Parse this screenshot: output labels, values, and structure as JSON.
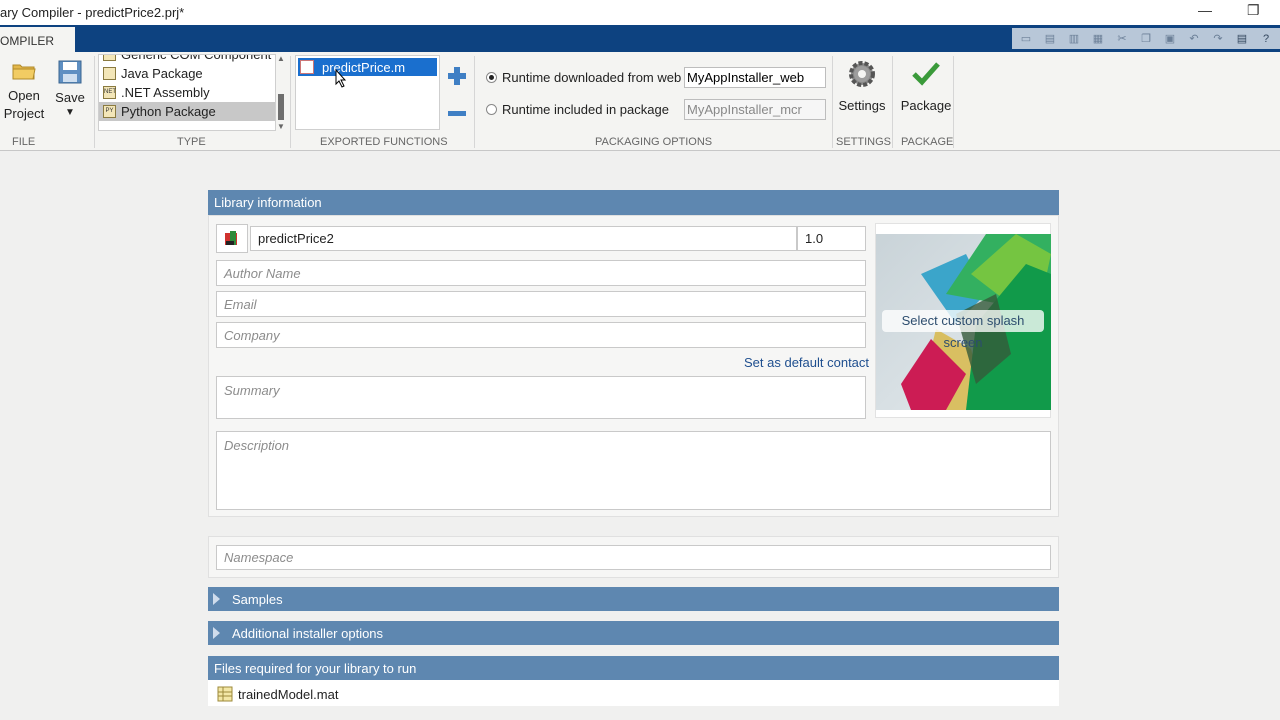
{
  "window": {
    "title": "ary Compiler - predictPrice2.prj*",
    "minimize_glyph": "—",
    "restore_glyph": "❐"
  },
  "tabs": {
    "compiler": "OMPILER"
  },
  "ribbon": {
    "file": {
      "open_label_1": "Open",
      "open_label_2": "Project",
      "save_label": "Save",
      "section": "FILE"
    },
    "type": {
      "items": [
        {
          "label": "Generic COM Component",
          "icon": "COM"
        },
        {
          "label": "Java Package",
          "icon": ""
        },
        {
          "label": ".NET Assembly",
          "icon": "NET"
        },
        {
          "label": "Python Package",
          "icon": "PY"
        }
      ],
      "selected": "Python Package",
      "section": "TYPE"
    },
    "exported_functions": {
      "items": [
        "predictPrice.m"
      ],
      "section": "EXPORTED FUNCTIONS"
    },
    "packaging": {
      "runtime_web_label": "Runtime downloaded from web",
      "runtime_web_value": "MyAppInstaller_web",
      "runtime_pkg_label": "Runtime included in package",
      "runtime_pkg_value": "MyAppInstaller_mcr",
      "section": "PACKAGING OPTIONS"
    },
    "settings": {
      "label": "Settings",
      "section": "SETTINGS"
    },
    "package": {
      "label": "Package",
      "section": "PACKAGE"
    }
  },
  "library_info": {
    "header": "Library information",
    "name": "predictPrice2",
    "version": "1.0",
    "author_placeholder": "Author Name",
    "email_placeholder": "Email",
    "company_placeholder": "Company",
    "default_contact_link": "Set as default contact",
    "summary_placeholder": "Summary",
    "description_placeholder": "Description",
    "splash_label": "Select custom splash screen"
  },
  "namespace_placeholder": "Namespace",
  "sections": {
    "samples": "Samples",
    "installer_options": "Additional installer options",
    "files_required": "Files required for your library to run"
  },
  "files": [
    {
      "name": "trainedModel.mat"
    }
  ],
  "colors": {
    "accent": "#0d4280",
    "panel_header": "#5e87b0",
    "selection": "#1a6fce",
    "link": "#1f4f8f"
  }
}
